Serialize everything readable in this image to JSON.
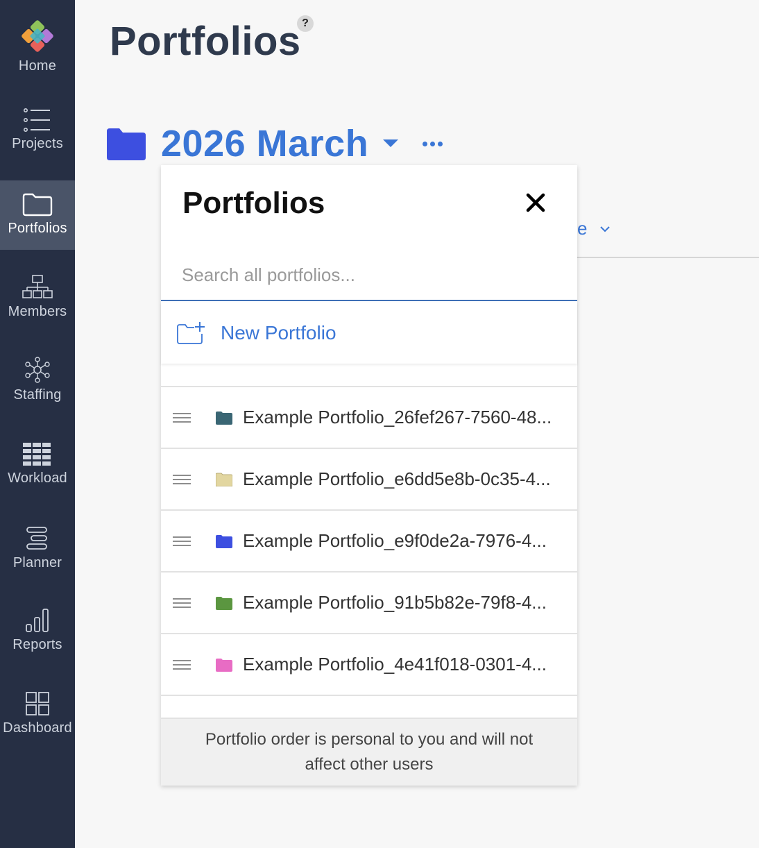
{
  "sidebar": {
    "items": [
      {
        "label": "Home",
        "icon": "logo-icon",
        "active": false
      },
      {
        "label": "Projects",
        "icon": "list-icon",
        "active": false
      },
      {
        "label": "Portfolios",
        "icon": "folder-icon",
        "active": true
      },
      {
        "label": "Members",
        "icon": "org-chart-icon",
        "active": false
      },
      {
        "label": "Staffing",
        "icon": "network-icon",
        "active": false
      },
      {
        "label": "Workload",
        "icon": "grid-icon",
        "active": false
      },
      {
        "label": "Planner",
        "icon": "planner-icon",
        "active": false
      },
      {
        "label": "Reports",
        "icon": "bar-chart-icon",
        "active": false
      },
      {
        "label": "Dashboard",
        "icon": "dashboard-icon",
        "active": false
      }
    ]
  },
  "header": {
    "title": "Portfolios",
    "help": "?"
  },
  "current_portfolio": {
    "name": "2026 March",
    "color": "#3d4fe0"
  },
  "background": {
    "tab_fragment": "e"
  },
  "panel": {
    "title": "Portfolios",
    "search_placeholder": "Search all portfolios...",
    "new_portfolio_label": "New Portfolio",
    "items": [
      {
        "label": "Example Portfolio_26fef267-7560-48...",
        "color": "#3a6674"
      },
      {
        "label": "Example Portfolio_e6dd5e8b-0c35-4...",
        "color": "#e2d6a0"
      },
      {
        "label": "Example Portfolio_e9f0de2a-7976-4...",
        "color": "#3d4fe0"
      },
      {
        "label": "Example Portfolio_91b5b82e-79f8-4...",
        "color": "#5b9640"
      },
      {
        "label": "Example Portfolio_4e41f018-0301-4...",
        "color": "#e86cc4"
      }
    ],
    "footer_note": "Portfolio order is personal to you and will not affect other users"
  },
  "colors": {
    "sidebar_bg": "#262f44",
    "sidebar_active": "#4a5468",
    "accent": "#3a76d6",
    "title": "#2f3a4d"
  }
}
